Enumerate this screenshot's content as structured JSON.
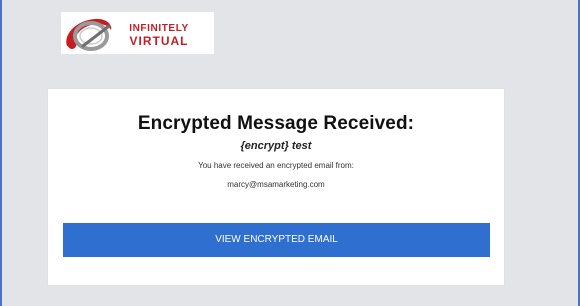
{
  "logo": {
    "line1": "INFINITELY",
    "line2": "VIRTUAL",
    "accent": "#c41e24",
    "ring_color": "#9a9a9a"
  },
  "email": {
    "title": "Encrypted Message Received:",
    "subject": "{encrypt} test",
    "note": "You have received an encrypted email from:",
    "sender": "marcy@msamarketing.com",
    "button_label": "VIEW ENCRYPTED EMAIL"
  },
  "colors": {
    "background": "#e3e4e8",
    "card": "#ffffff",
    "button": "#2f6fd0",
    "frame_edge": "#4a74c9"
  }
}
